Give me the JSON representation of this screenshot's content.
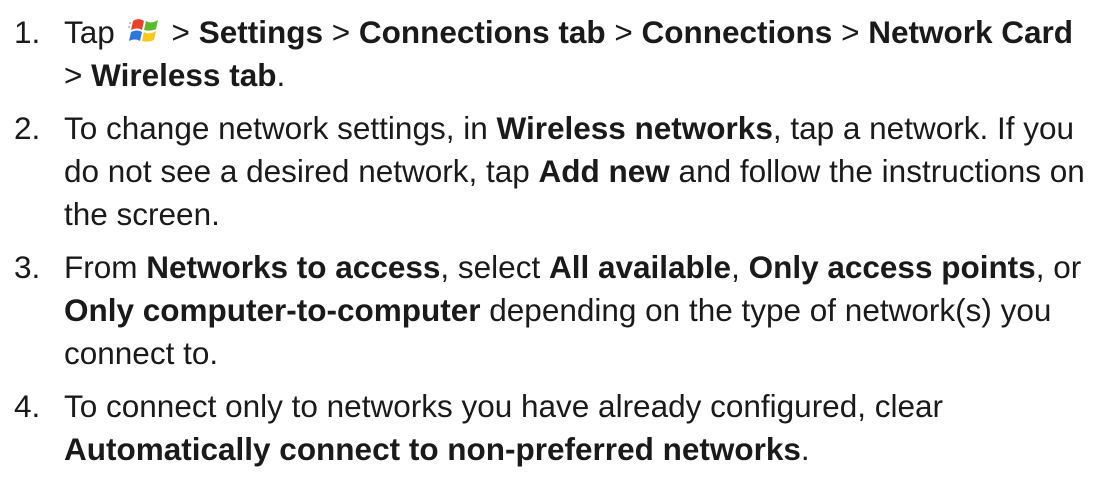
{
  "steps": [
    {
      "number": "1.",
      "segments": [
        {
          "text": "Tap ",
          "bold": false
        },
        {
          "icon": "windows-start-icon"
        },
        {
          "text": "> ",
          "bold": false
        },
        {
          "text": "Settings",
          "bold": true
        },
        {
          "text": " > ",
          "bold": false
        },
        {
          "text": "Connections tab",
          "bold": true
        },
        {
          "text": " > ",
          "bold": false
        },
        {
          "text": "Connections",
          "bold": true
        },
        {
          "text": " > ",
          "bold": false
        },
        {
          "text": "Network Card",
          "bold": true
        },
        {
          "text": " > ",
          "bold": false
        },
        {
          "text": "Wireless tab",
          "bold": true
        },
        {
          "text": ".",
          "bold": false
        }
      ]
    },
    {
      "number": "2.",
      "segments": [
        {
          "text": "To change network settings, in ",
          "bold": false
        },
        {
          "text": "Wireless networks",
          "bold": true
        },
        {
          "text": ", tap a network. If you do not see a desired network, tap ",
          "bold": false
        },
        {
          "text": "Add new",
          "bold": true
        },
        {
          "text": " and follow the instructions on the screen.",
          "bold": false
        }
      ]
    },
    {
      "number": "3.",
      "segments": [
        {
          "text": "From ",
          "bold": false
        },
        {
          "text": "Networks to access",
          "bold": true
        },
        {
          "text": ", select ",
          "bold": false
        },
        {
          "text": "All available",
          "bold": true
        },
        {
          "text": ", ",
          "bold": false
        },
        {
          "text": "Only access points",
          "bold": true
        },
        {
          "text": ", or ",
          "bold": false
        },
        {
          "text": "Only computer-to-computer",
          "bold": true
        },
        {
          "text": " depending on the type of network(s) you connect to.",
          "bold": false
        }
      ]
    },
    {
      "number": "4.",
      "segments": [
        {
          "text": "To connect only to networks you have already configured, clear ",
          "bold": false
        },
        {
          "text": "Automatically connect to non-preferred networks",
          "bold": true
        },
        {
          "text": ".",
          "bold": false
        }
      ]
    }
  ],
  "icon_colors": {
    "red": "#e8412c",
    "green": "#5cb82f",
    "blue": "#2f78d9",
    "yellow": "#f7c81e"
  }
}
